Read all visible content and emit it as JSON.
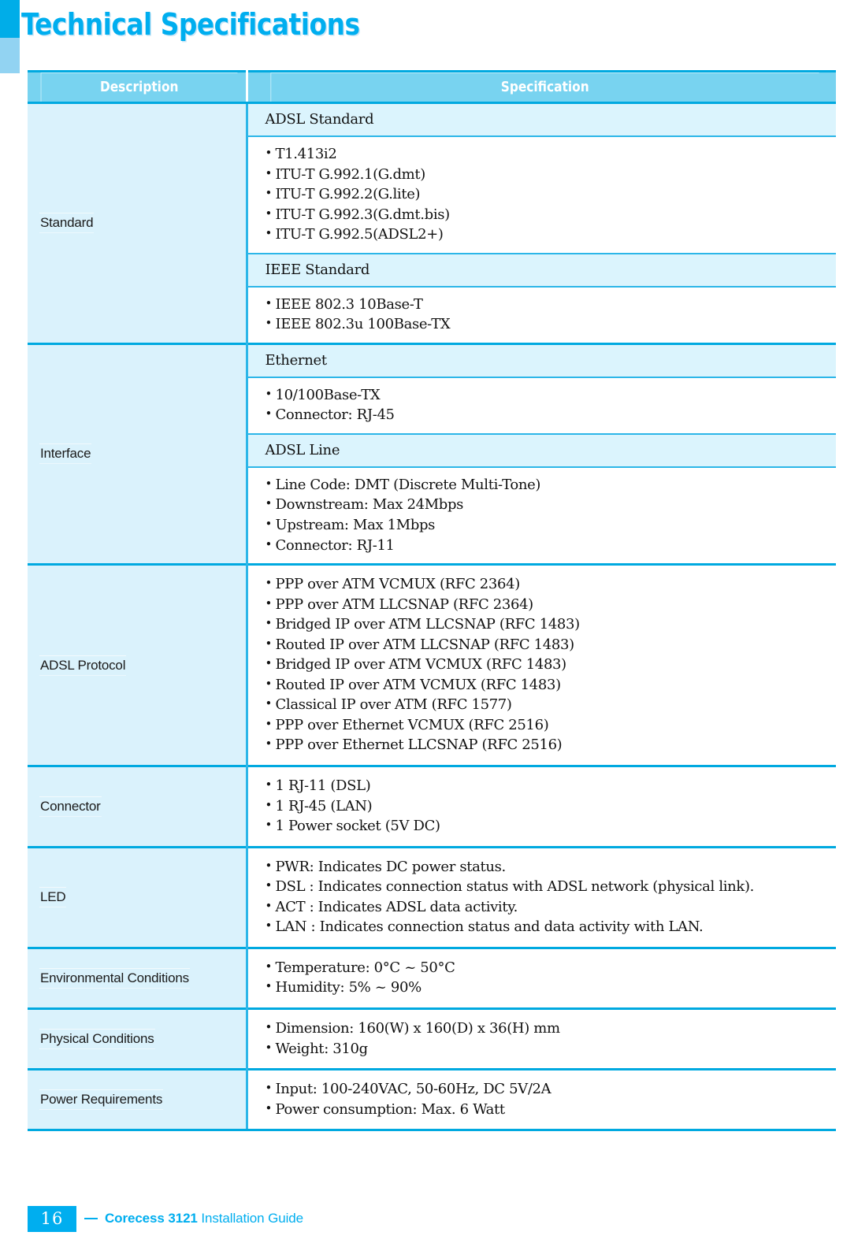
{
  "page": {
    "title": "Technical Specifications"
  },
  "table": {
    "headers": {
      "description": "Description",
      "specification": "Specification"
    },
    "sections": [
      {
        "label": "Standard",
        "blocks": [
          {
            "subheading": "ADSL Standard",
            "items": [
              "T1.413i2",
              "ITU-T G.992.1(G.dmt)",
              "ITU-T G.992.2(G.lite)",
              "ITU-T G.992.3(G.dmt.bis)",
              "ITU-T G.992.5(ADSL2+)"
            ]
          },
          {
            "subheading": "IEEE Standard",
            "items": [
              "IEEE 802.3 10Base-T",
              "IEEE 802.3u 100Base-TX"
            ]
          }
        ]
      },
      {
        "label": "Interface",
        "blocks": [
          {
            "subheading": "Ethernet",
            "items": [
              "10/100Base-TX",
              "Connector: RJ-45"
            ]
          },
          {
            "subheading": "ADSL Line",
            "items": [
              "Line Code: DMT (Discrete Multi-Tone)",
              "Downstream: Max 24Mbps",
              "Upstream: Max 1Mbps",
              "Connector: RJ-11"
            ]
          }
        ]
      },
      {
        "label": "ADSL Protocol",
        "blocks": [
          {
            "subheading": null,
            "items": [
              "PPP over ATM VCMUX (RFC 2364)",
              "PPP over ATM LLCSNAP (RFC 2364)",
              "Bridged IP over ATM LLCSNAP (RFC 1483)",
              "Routed IP over ATM LLCSNAP (RFC 1483)",
              "Bridged IP over ATM VCMUX (RFC 1483)",
              "Routed IP over ATM VCMUX (RFC 1483)",
              "Classical IP over ATM (RFC 1577)",
              "PPP over Ethernet VCMUX (RFC 2516)",
              "PPP over Ethernet LLCSNAP (RFC 2516)"
            ]
          }
        ]
      },
      {
        "label": "Connector",
        "blocks": [
          {
            "subheading": null,
            "items": [
              "1 RJ-11 (DSL)",
              "1 RJ-45 (LAN)",
              "1 Power socket (5V DC)"
            ]
          }
        ]
      },
      {
        "label": "LED",
        "blocks": [
          {
            "subheading": null,
            "items": [
              "PWR: Indicates DC power status.",
              "DSL : Indicates connection status with ADSL network (physical link).",
              "ACT : Indicates ADSL data activity.",
              "LAN : Indicates connection status and data activity with LAN."
            ]
          }
        ]
      },
      {
        "label": "Environmental Conditions",
        "blocks": [
          {
            "subheading": null,
            "items": [
              "Temperature: 0°C ~ 50°C",
              "Humidity: 5% ~ 90%"
            ]
          }
        ]
      },
      {
        "label": "Physical Conditions",
        "blocks": [
          {
            "subheading": null,
            "items": [
              "Dimension: 160(W) x 160(D) x 36(H) mm",
              "Weight: 310g"
            ]
          }
        ]
      },
      {
        "label": "Power Requirements",
        "blocks": [
          {
            "subheading": null,
            "items": [
              "Input: 100-240VAC, 50-60Hz, DC 5V/2A",
              "Power consumption: Max. 6 Watt"
            ]
          }
        ]
      }
    ]
  },
  "footer": {
    "page_number": "16",
    "brand": "Corecess 3121",
    "doc_title": "Installation Guide"
  },
  "colors": {
    "accent": "#00AEEF",
    "header_bg": "#78D3F0",
    "desc_bg": "#DAF2FC",
    "subhead_bg": "#DBF4FD",
    "rule": "#2CB6E8",
    "rule_strong": "#00A9E0",
    "deco_light": "#92D3F2"
  }
}
